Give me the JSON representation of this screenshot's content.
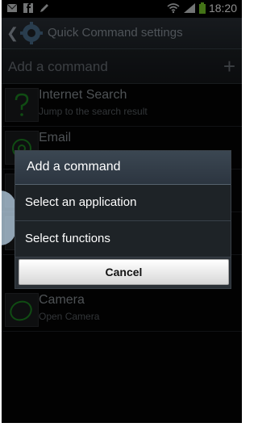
{
  "status_bar": {
    "time": "18:20"
  },
  "title_bar": {
    "title": "Quick Command settings"
  },
  "list_header": {
    "label": "Add a command",
    "add_symbol": "+"
  },
  "rows": [
    {
      "name": "Internet Search",
      "subtitle": "Jump to the search result",
      "icon": "question-mark-gesture-icon"
    },
    {
      "name": "Email",
      "subtitle": "",
      "icon": "at-sign-gesture-icon"
    },
    {
      "name": "",
      "subtitle": "",
      "icon": "hidden-gesture-icon"
    },
    {
      "name": "",
      "subtitle": "",
      "icon": "hidden-gesture-icon"
    },
    {
      "name": "Camera",
      "subtitle": "Open Camera",
      "icon": "circle-gesture-icon"
    }
  ],
  "dialog": {
    "title": "Add a command",
    "options": [
      "Select an application",
      "Select functions"
    ],
    "cancel_label": "Cancel"
  },
  "colors": {
    "accent_green": "#1e8b24",
    "dialog_title_bg": "#2c3540"
  }
}
